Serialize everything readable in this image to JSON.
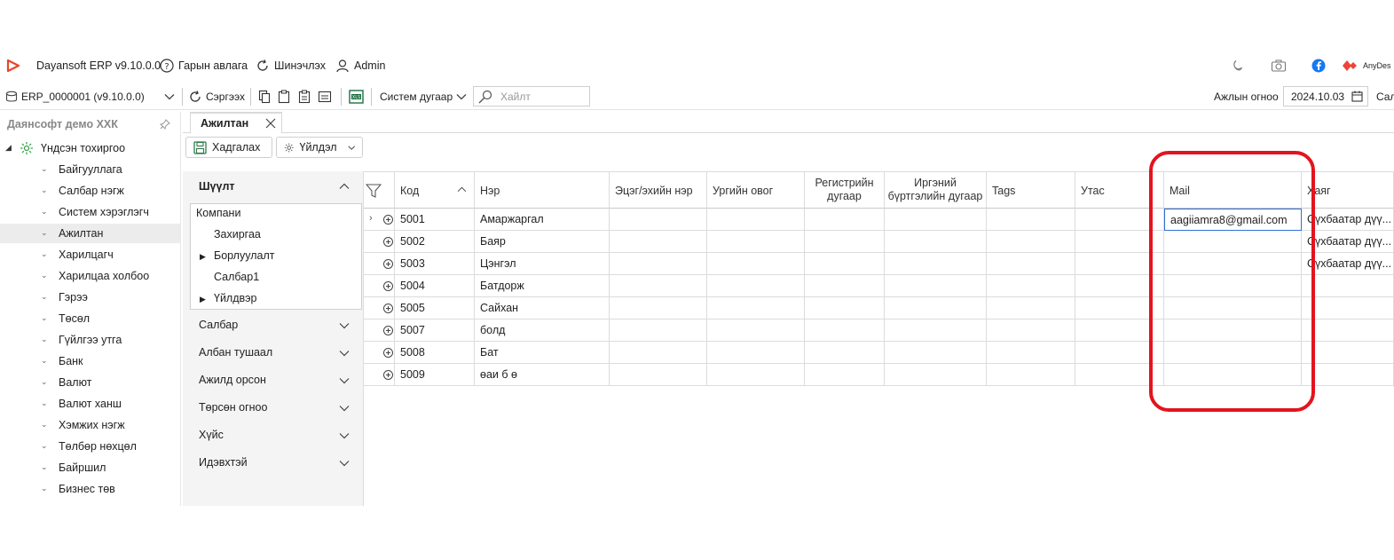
{
  "titlebar": {
    "app_name": "Dayansoft ERP v9.10.0.0",
    "help_label": "Гарын авлага",
    "update_label": "Шинэчлэх",
    "user_label": "Admin",
    "anydesk_label": "AnyDes"
  },
  "toolbar": {
    "database": "ERP_0000001 (v9.10.0.0)",
    "refresh_label": "Сэргээх",
    "system_number_label": "Систем дугаар",
    "search_placeholder": "Хайлт",
    "workday_label": "Ажлын огноо",
    "workday_value": "2024.10.03",
    "cut_label": "Сал"
  },
  "sidebar": {
    "company": "Даянсофт демо ХХК",
    "root": "Үндсэн тохиргоо",
    "items": [
      {
        "label": "Байгууллага"
      },
      {
        "label": "Салбар нэгж"
      },
      {
        "label": "Систем хэрэглэгч"
      },
      {
        "label": "Ажилтан"
      },
      {
        "label": "Харилцагч"
      },
      {
        "label": "Харилцаа холбоо"
      },
      {
        "label": "Гэрээ"
      },
      {
        "label": "Төсөл"
      },
      {
        "label": "Гүйлгээ утга"
      },
      {
        "label": "Банк"
      },
      {
        "label": "Валют"
      },
      {
        "label": "Валют ханш"
      },
      {
        "label": "Хэмжих нэгж"
      },
      {
        "label": "Төлбөр нөхцөл"
      },
      {
        "label": "Байршил"
      },
      {
        "label": "Бизнес төв"
      }
    ],
    "selected_index": 3
  },
  "tab": {
    "label": "Ажилтан"
  },
  "actions": {
    "save_label": "Хадгалах",
    "action_label": "Үйлдэл"
  },
  "filter": {
    "title": "Шүүлт",
    "list": [
      {
        "label": "Компани"
      },
      {
        "label": "Захиргаа"
      },
      {
        "label": "Борлуулалт"
      },
      {
        "label": "Салбар1"
      },
      {
        "label": "Үйлдвэр"
      }
    ],
    "groups": [
      {
        "label": "Салбар"
      },
      {
        "label": "Албан тушаал"
      },
      {
        "label": "Ажилд орсон"
      },
      {
        "label": "Төрсөн огноо"
      },
      {
        "label": "Хүйс"
      },
      {
        "label": "Идэвхтэй"
      }
    ]
  },
  "grid": {
    "columns": [
      {
        "label": "Код"
      },
      {
        "label": "Нэр"
      },
      {
        "label": "Эцэг/эхийн нэр"
      },
      {
        "label": "Ургийн овог"
      },
      {
        "label": "Регистрийн дугаар"
      },
      {
        "label": "Иргэний бүртгэлийн дугаар"
      },
      {
        "label": "Tags"
      },
      {
        "label": "Утас"
      },
      {
        "label": "Mail"
      },
      {
        "label": "Хаяг"
      }
    ],
    "rows": [
      {
        "code": "5001",
        "name": "Амаржаргал",
        "mail": "aagiiamra8@gmail.com",
        "address": "Сүхбаатар дүү..."
      },
      {
        "code": "5002",
        "name": "Баяр",
        "mail": "",
        "address": "Сүхбаатар дүү..."
      },
      {
        "code": "5003",
        "name": "Цэнгэл",
        "mail": "",
        "address": "Сүхбаатар дүү..."
      },
      {
        "code": "5004",
        "name": "Батдорж",
        "mail": "",
        "address": ""
      },
      {
        "code": "5005",
        "name": "Сайхан",
        "mail": "",
        "address": ""
      },
      {
        "code": "5007",
        "name": "болд",
        "mail": "",
        "address": ""
      },
      {
        "code": "5008",
        "name": "Бат",
        "mail": "",
        "address": ""
      },
      {
        "code": "5009",
        "name": "өаи б ө",
        "mail": "",
        "address": ""
      }
    ]
  },
  "colors": {
    "accent": "#e3141f",
    "selection": "#2f6fd6",
    "panel_bg": "#f4f4f4",
    "app_icon": "#e8462a"
  }
}
